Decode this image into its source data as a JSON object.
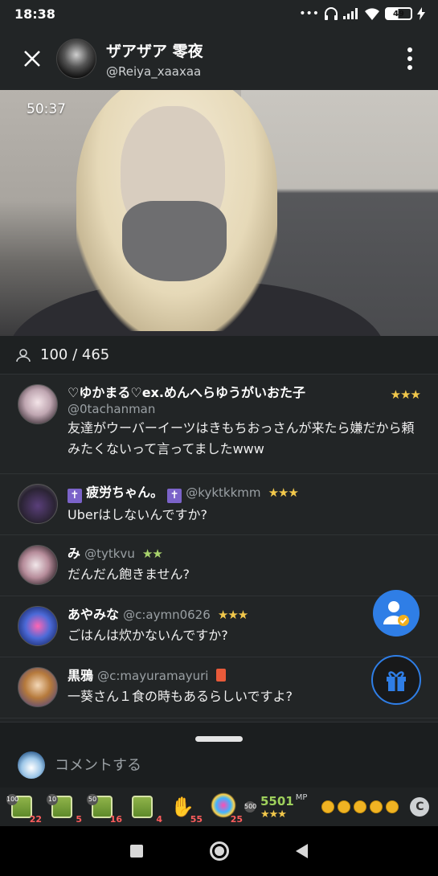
{
  "status_bar": {
    "time": "18:38",
    "battery": "49"
  },
  "header": {
    "host_name": "ザアザア 零夜",
    "host_handle": "@Reiya_xaaxaa"
  },
  "video": {
    "elapsed": "50:37"
  },
  "viewers": {
    "count": "100 / 465"
  },
  "comments": [
    {
      "name": "♡ゆかまる♡ex.めんへらゆうがいおた子",
      "handle": "@0tachanman",
      "text": "友達がウーバーイーツはきもちおっさんが来たら嫌だから頼みたくないって言ってましたwww",
      "stars": "★★★"
    },
    {
      "name": "疲労ちゃん。",
      "handle": "@kyktkkmm",
      "text": "Uberはしないんですか?",
      "stars": "★★★",
      "cross": "✝"
    },
    {
      "name": "み",
      "handle": "@tytkvu",
      "text": "だんだん飽きません?",
      "stars": "★★"
    },
    {
      "name": "あやみな",
      "handle": "@c:aymn0626",
      "text": "ごはんは炊かないんですか?",
      "stars": "★★★"
    },
    {
      "name": "黒鴉",
      "handle": "@c:mayuramayuri",
      "text": "一葵さん１食の時もあるらしいですよ?"
    }
  ],
  "comment_input": {
    "placeholder": "コメントする"
  },
  "gifts": [
    {
      "tag": "100",
      "count": "22"
    },
    {
      "tag": "10",
      "count": "5"
    },
    {
      "tag": "50",
      "count": "16"
    },
    {
      "tag": "",
      "count": "4"
    },
    {
      "tag": "",
      "count": "55"
    },
    {
      "tag": "",
      "count": "25"
    }
  ],
  "points": {
    "value": "5501",
    "unit": "MP",
    "stars": "★★★",
    "tag": "500",
    "currency": "C"
  },
  "colors": {
    "accent": "#2f7ee6",
    "background": "#222526",
    "star": "#f2c84b",
    "points": "#9ed05c"
  }
}
